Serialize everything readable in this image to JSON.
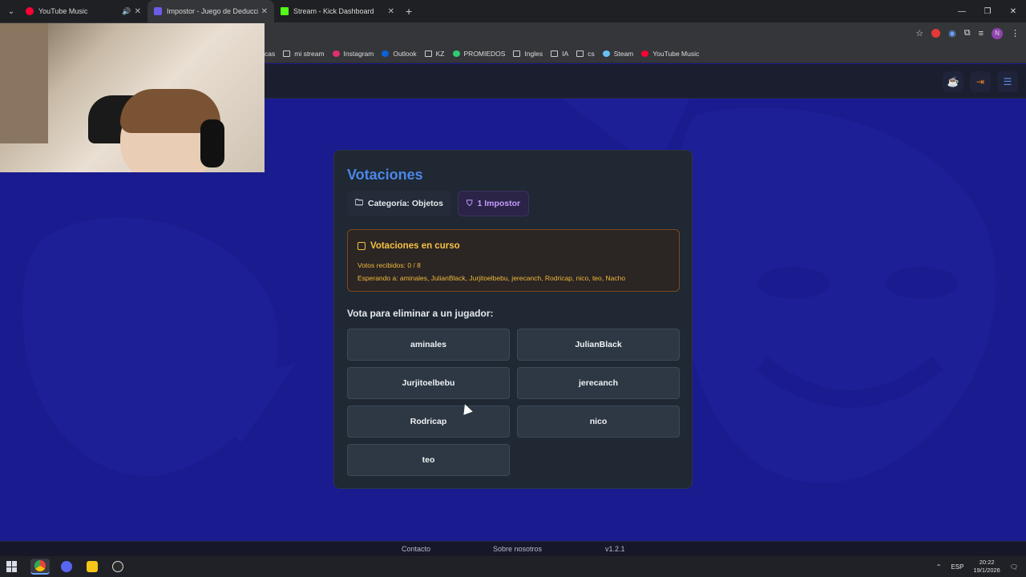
{
  "browser": {
    "tabs": [
      {
        "title": "YouTube Music",
        "icon": "youtube-music-icon",
        "color": "#ff0033"
      },
      {
        "title": "Impostor - Juego de Deducción",
        "icon": "impostor-icon",
        "color": "#6c5ce7"
      },
      {
        "title": "Stream - Kick Dashboard",
        "icon": "kick-icon",
        "color": "#53fc18"
      }
    ],
    "profile_initial": "N",
    "bookmarks": [
      {
        "label": "cas",
        "icon": "folder-icon"
      },
      {
        "label": "mi stream",
        "icon": "folder-icon"
      },
      {
        "label": "Instagram",
        "icon": "instagram-icon"
      },
      {
        "label": "Outlook",
        "icon": "outlook-icon"
      },
      {
        "label": "KZ",
        "icon": "folder-icon"
      },
      {
        "label": "PROMIEDOS",
        "icon": "promiedos-icon"
      },
      {
        "label": "Ingles",
        "icon": "folder-icon"
      },
      {
        "label": "IA",
        "icon": "folder-icon"
      },
      {
        "label": "cs",
        "icon": "folder-icon"
      },
      {
        "label": "Steam",
        "icon": "steam-icon"
      },
      {
        "label": "YouTube Music",
        "icon": "youtube-music-icon"
      }
    ]
  },
  "game": {
    "title": "Votaciones",
    "category_chip": "Categoría: Objetos",
    "impostor_chip": "1 Impostor",
    "status": {
      "heading": "Votaciones en curso",
      "votes": "Votos recibidos: 0 / 8",
      "waiting": "Esperando a: aminales, JulianBlack, Jurjitoelbebu, jerecanch, Rodricap, nico, teo, Nacho"
    },
    "vote_prompt": "Vota para eliminar a un jugador:",
    "players": [
      "aminales",
      "JulianBlack",
      "Jurjitoelbebu",
      "jerecanch",
      "Rodricap",
      "nico",
      "teo"
    ]
  },
  "footer": {
    "contact": "Contacto",
    "about": "Sobre nosotros",
    "version": "v1.2.1"
  },
  "taskbar": {
    "lang": "ESP",
    "time": "20:22",
    "date": "19/1/2026"
  }
}
